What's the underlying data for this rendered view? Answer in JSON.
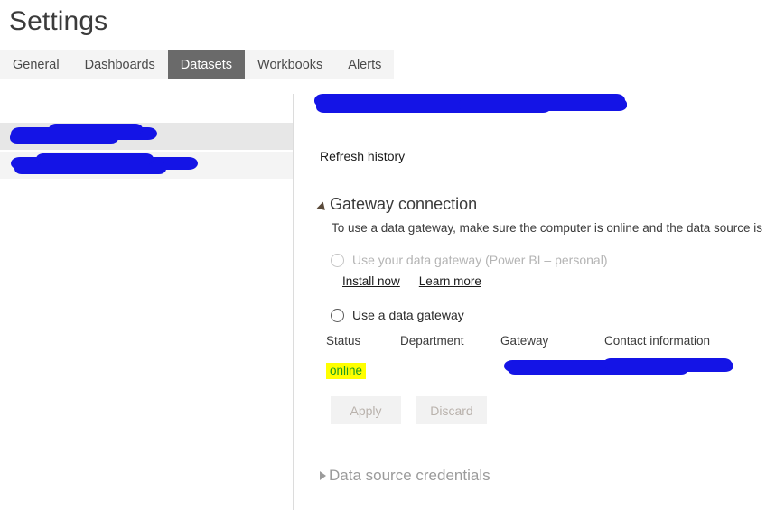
{
  "page": {
    "title": "Settings"
  },
  "tabs": [
    {
      "label": "General",
      "selected": false
    },
    {
      "label": "Dashboards",
      "selected": false
    },
    {
      "label": "Datasets",
      "selected": true
    },
    {
      "label": "Workbooks",
      "selected": false
    },
    {
      "label": "Alerts",
      "selected": false
    }
  ],
  "sidebar": {
    "items": [
      {
        "label": "",
        "redacted": true,
        "selected": true
      },
      {
        "label": "",
        "redacted": true,
        "selected": false
      }
    ]
  },
  "detail": {
    "dataset_title": "",
    "dataset_title_redacted": true,
    "refresh_history_link": "Refresh history",
    "gateway_section": {
      "title": "Gateway connection",
      "expander_icon": "triangle-down-icon",
      "expanded": true,
      "description": "To use a data gateway, make sure the computer is online and the data source is add",
      "options": [
        {
          "label": "Use your data gateway (Power BI – personal)",
          "selected": false,
          "disabled": true
        },
        {
          "label": "Use a data gateway",
          "selected": false,
          "disabled": false
        }
      ],
      "links": [
        {
          "label": "Install now"
        },
        {
          "label": "Learn more"
        }
      ],
      "table": {
        "columns": [
          "Status",
          "Department",
          "Gateway",
          "Contact information"
        ],
        "rows": [
          {
            "status": "online",
            "status_highlight_color": "#ffff00",
            "status_text_color": "#1f9b1f",
            "department": "",
            "gateway": "",
            "gateway_redacted": true,
            "contact_information": ""
          }
        ]
      },
      "buttons": [
        {
          "label": "Apply",
          "disabled": true
        },
        {
          "label": "Discard",
          "disabled": true
        }
      ]
    },
    "credentials_section": {
      "title": "Data source credentials",
      "expander_icon": "triangle-right-icon",
      "expanded": false
    }
  },
  "colors": {
    "tab_selected_bg": "#6a6a6a",
    "tab_strip_bg": "#f4f4f4",
    "redaction_marker": "#1414e6",
    "highlight_yellow": "#ffff00",
    "status_green": "#1f9b1f"
  }
}
